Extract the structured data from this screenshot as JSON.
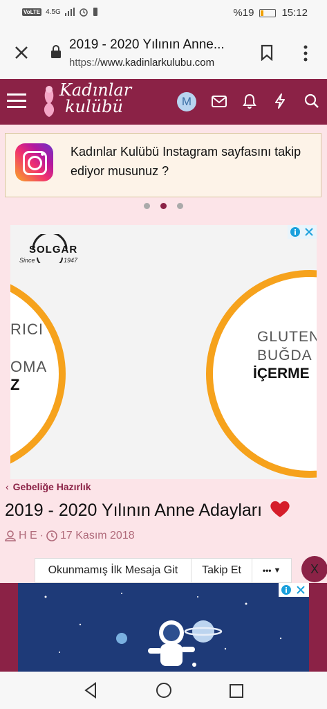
{
  "status_bar": {
    "volte": "VoLTE",
    "network": "4.5G",
    "battery_percent": "%19",
    "time": "15:12"
  },
  "browser": {
    "page_title": "2019 - 2020 Yılının Anne...",
    "url_scheme": "https://",
    "url_domain": "www.kadinlarkulubu.com"
  },
  "site": {
    "logo_line1": "Kadınlar",
    "logo_line2": "kulübü",
    "avatar_letter": "M"
  },
  "banner": {
    "text": "Kadınlar Kulübü Instagram sayfasını takip ediyor musunuz ?"
  },
  "ad": {
    "brand": "SOLGAR",
    "since": "Since",
    "year": "1947",
    "left_line1": "RICI",
    "left_line2": "OMA",
    "left_line3": "Z",
    "right_line1": "GLUTEN",
    "right_line2": "BUĞDA",
    "right_line3": "İÇERME"
  },
  "thread": {
    "breadcrumb": "Gebeliğe Hazırlık",
    "title": "2019 - 2020 Yılının Anne Adayları",
    "author": "H E",
    "date": "17 Kasım 2018"
  },
  "actions": {
    "unread": "Okunmamış İlk Mesaja Git",
    "follow": "Takip Et",
    "more": "•••",
    "close": "X"
  },
  "colors": {
    "brand": "#8b2246",
    "page_bg": "#fce4e8",
    "accent_orange": "#f6a21c"
  }
}
